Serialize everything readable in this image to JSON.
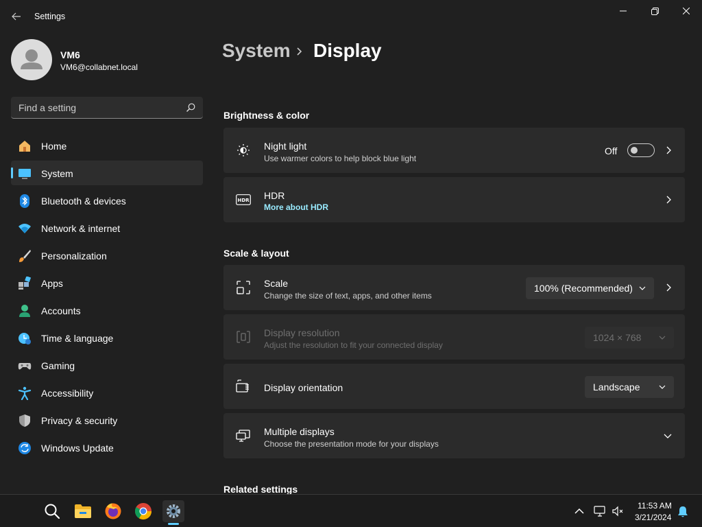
{
  "window": {
    "title": "Settings"
  },
  "user": {
    "name": "VM6",
    "email": "VM6@collabnet.local"
  },
  "search": {
    "placeholder": "Find a setting",
    "value": ""
  },
  "sidebar": {
    "items": [
      {
        "label": "Home",
        "icon": "home-icon"
      },
      {
        "label": "System",
        "icon": "system-icon",
        "active": true
      },
      {
        "label": "Bluetooth & devices",
        "icon": "bluetooth-icon"
      },
      {
        "label": "Network & internet",
        "icon": "network-icon"
      },
      {
        "label": "Personalization",
        "icon": "personalization-icon"
      },
      {
        "label": "Apps",
        "icon": "apps-icon"
      },
      {
        "label": "Accounts",
        "icon": "accounts-icon"
      },
      {
        "label": "Time & language",
        "icon": "time-language-icon"
      },
      {
        "label": "Gaming",
        "icon": "gaming-icon"
      },
      {
        "label": "Accessibility",
        "icon": "accessibility-icon"
      },
      {
        "label": "Privacy & security",
        "icon": "privacy-icon"
      },
      {
        "label": "Windows Update",
        "icon": "windows-update-icon"
      }
    ]
  },
  "breadcrumb": {
    "parent": "System",
    "current": "Display"
  },
  "sections": {
    "brightness": "Brightness & color",
    "scale_layout": "Scale & layout",
    "related": "Related settings"
  },
  "cards": {
    "night_light": {
      "title": "Night light",
      "subtitle": "Use warmer colors to help block blue light",
      "toggle_label": "Off",
      "icon": "night-light-icon"
    },
    "hdr": {
      "title": "HDR",
      "link": "More about HDR",
      "icon": "hdr-icon"
    },
    "scale": {
      "title": "Scale",
      "subtitle": "Change the size of text, apps, and other items",
      "value": "100% (Recommended)",
      "icon": "scale-icon"
    },
    "resolution": {
      "title": "Display resolution",
      "subtitle": "Adjust the resolution to fit your connected display",
      "value": "1024 × 768",
      "icon": "resolution-icon",
      "disabled": true
    },
    "orientation": {
      "title": "Display orientation",
      "value": "Landscape",
      "icon": "orientation-icon"
    },
    "multiple": {
      "title": "Multiple displays",
      "subtitle": "Choose the presentation mode for your displays",
      "icon": "multiple-displays-icon"
    }
  },
  "taskbar": {
    "apps": [
      "search-icon",
      "file-explorer-icon",
      "firefox-icon",
      "chrome-icon",
      "settings-icon"
    ],
    "clock": {
      "time": "11:53 AM",
      "date": "3/21/2024"
    }
  },
  "colors": {
    "accent": "#60cdff",
    "link": "#99ebff",
    "background": "#202020",
    "card": "#2b2b2b"
  }
}
